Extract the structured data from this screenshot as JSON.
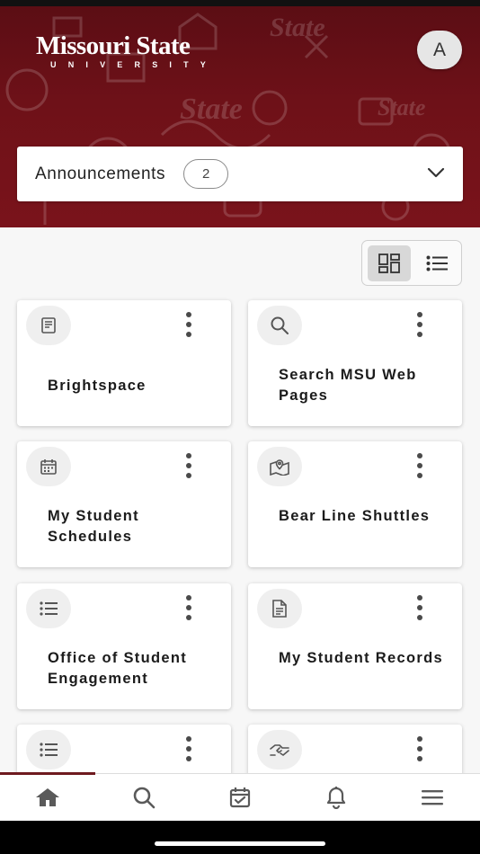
{
  "header": {
    "logo_word": "Missouri State",
    "logo_sub": "UNIVERSITY",
    "avatar_letter": "A",
    "brand_color": "#6e1118"
  },
  "announcements": {
    "title": "Announcements",
    "count": "2",
    "icon": "chevron-down-icon"
  },
  "view_toggle": {
    "active": "grid",
    "options": [
      "grid-view-icon",
      "list-view-icon"
    ]
  },
  "cards": [
    {
      "label": "Brightspace",
      "icon": "book-icon"
    },
    {
      "label": "Search MSU Web Pages",
      "icon": "search-icon"
    },
    {
      "label": "My Student Schedules",
      "icon": "calendar-icon"
    },
    {
      "label": "Bear Line Shuttles",
      "icon": "map-pin-icon"
    },
    {
      "label": "Office of Student Engagement",
      "icon": "list-icon"
    },
    {
      "label": "My Student Records",
      "icon": "document-icon"
    },
    {
      "label": "",
      "icon": "list-icon"
    },
    {
      "label": "",
      "icon": "handshake-icon"
    }
  ],
  "bottom_nav": [
    {
      "name": "home",
      "icon": "home-icon",
      "active": true
    },
    {
      "name": "search",
      "icon": "search-icon",
      "active": false
    },
    {
      "name": "tasks",
      "icon": "calendar-check-icon",
      "active": false
    },
    {
      "name": "notifications",
      "icon": "bell-icon",
      "active": false
    },
    {
      "name": "menu",
      "icon": "hamburger-menu-icon",
      "active": false
    }
  ]
}
